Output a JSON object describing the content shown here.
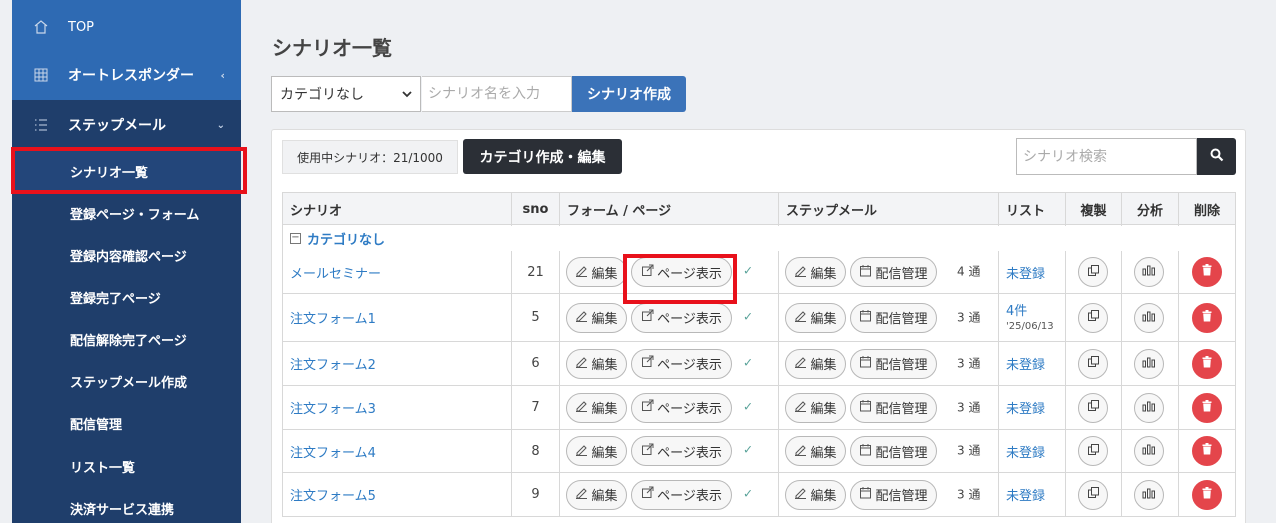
{
  "sidebar": {
    "top_label": "TOP",
    "autoresponder_label": "オートレスポンダー",
    "step_label": "ステップメール",
    "items": [
      {
        "label": "シナリオ一覧"
      },
      {
        "label": "登録ページ・フォーム"
      },
      {
        "label": "登録内容確認ページ"
      },
      {
        "label": "登録完了ページ"
      },
      {
        "label": "配信解除完了ページ"
      },
      {
        "label": "ステップメール作成"
      },
      {
        "label": "配信管理"
      },
      {
        "label": "リスト一覧"
      },
      {
        "label": "決済サービス連携"
      }
    ]
  },
  "main": {
    "title": "シナリオ一覧",
    "category_select": "カテゴリなし",
    "name_placeholder": "シナリオ名を入力",
    "create_button": "シナリオ作成",
    "usage_text": "使用中シナリオ：21/1000",
    "category_button": "カテゴリ作成・編集",
    "search_placeholder": "シナリオ検索"
  },
  "table": {
    "headers": [
      "シナリオ",
      "sno",
      "フォーム / ページ",
      "ステップメール",
      "リスト",
      "複製",
      "分析",
      "削除"
    ],
    "category_label": "カテゴリなし",
    "edit_label": "編集",
    "page_view_label": "ページ表示",
    "delivery_label": "配信管理",
    "rows": [
      {
        "name": "メールセミナー",
        "sno": "21",
        "count": "4 通",
        "list": "未登録",
        "list_date": ""
      },
      {
        "name": "注文フォーム1",
        "sno": "5",
        "count": "3 通",
        "list": "4件",
        "list_date": "'25/06/13"
      },
      {
        "name": "注文フォーム2",
        "sno": "6",
        "count": "3 通",
        "list": "未登録",
        "list_date": ""
      },
      {
        "name": "注文フォーム3",
        "sno": "7",
        "count": "3 通",
        "list": "未登録",
        "list_date": ""
      },
      {
        "name": "注文フォーム4",
        "sno": "8",
        "count": "3 通",
        "list": "未登録",
        "list_date": ""
      },
      {
        "name": "注文フォーム5",
        "sno": "9",
        "count": "3 通",
        "list": "未登録",
        "list_date": ""
      }
    ]
  },
  "colors": {
    "sidebar_bg": "#1f3e6b",
    "sidebar_top": "#2e6ab3",
    "accent": "#3b73b9",
    "link": "#2e7bc4",
    "highlight": "#e8111b",
    "delete": "#e4454b"
  }
}
